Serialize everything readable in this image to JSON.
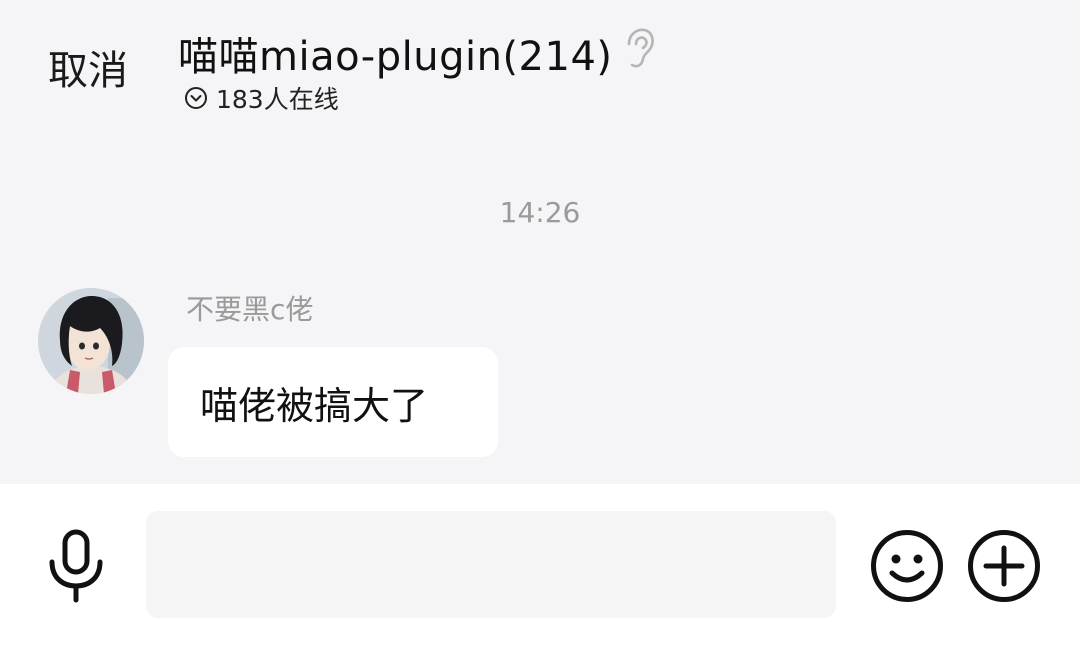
{
  "header": {
    "cancel_label": "取消",
    "title": "喵喵miao-plugin(214)",
    "online_text": "183人在线",
    "icons": {
      "ear": "ear-icon",
      "online": "chevron-down-circle-icon"
    }
  },
  "chat": {
    "timestamp": "14:26",
    "messages": [
      {
        "sender": "不要黑c佬",
        "text": "喵佬被搞大了"
      }
    ]
  },
  "input_bar": {
    "placeholder": "",
    "icons": {
      "mic": "microphone-icon",
      "emoji": "emoji-icon",
      "plus": "plus-icon"
    }
  },
  "colors": {
    "background": "#f5f4f6",
    "bubble": "#ffffff",
    "muted_text": "#9a9a9a",
    "input_fill": "#f5f5f5"
  }
}
